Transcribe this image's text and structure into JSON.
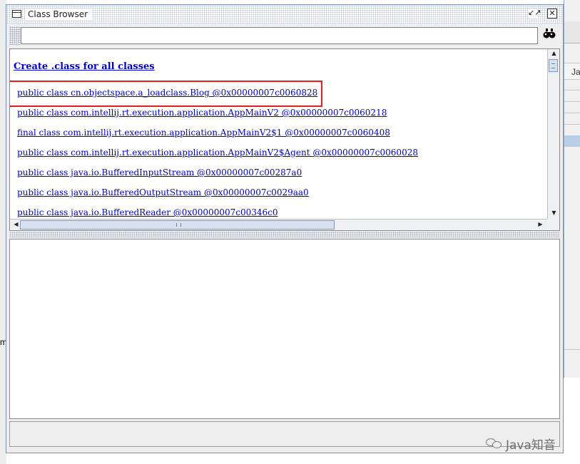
{
  "window": {
    "title": "Class Browser",
    "restore_glyph": "↙↗",
    "close_glyph": "✕"
  },
  "search": {
    "value": "",
    "placeholder": "",
    "find_icon": "binoculars-icon"
  },
  "class_list": {
    "create_link": "Create .class for all classes",
    "items": [
      "public class cn.objectspace.a_loadclass.Blog @0x00000007c0060828",
      "public class com.intellij.rt.execution.application.AppMainV2 @0x00000007c0060218",
      "final class com.intellij.rt.execution.application.AppMainV2$1 @0x00000007c0060408",
      "public class com.intellij.rt.execution.application.AppMainV2$Agent @0x00000007c0060028",
      "public class java.io.BufferedInputStream @0x00000007c00287a0",
      "public class java.io.BufferedOutputStream @0x00000007c0029aa0",
      "public class java.io.BufferedReader @0x00000007c00346c0"
    ],
    "highlighted_index": 0,
    "highlight_color": "#e02020"
  },
  "background": {
    "right_header": "Ja",
    "left_char": "m"
  },
  "watermark": {
    "text": "Java知音"
  },
  "colors": {
    "link": "#0000cc",
    "title_border": "#7b8fb3"
  }
}
